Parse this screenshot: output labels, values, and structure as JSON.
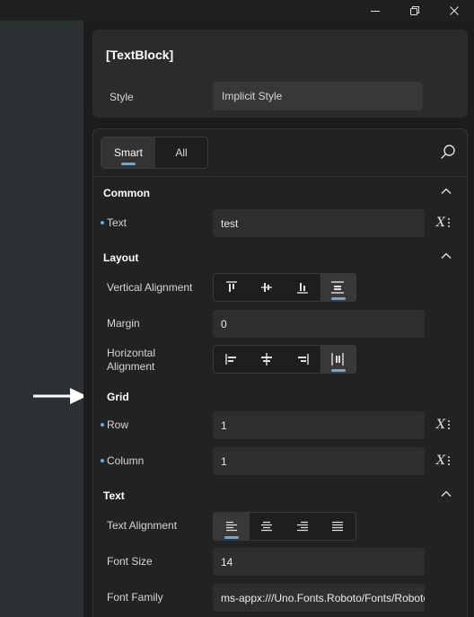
{
  "window": {
    "controls": [
      "minimize-icon",
      "restore-icon",
      "close-icon"
    ]
  },
  "header": {
    "title": "[TextBlock]",
    "style_label": "Style",
    "style_value": "Implicit Style"
  },
  "filter": {
    "smart_label": "Smart",
    "all_label": "All",
    "selected": "Smart",
    "search_icon": "search-icon"
  },
  "sections": {
    "common": {
      "title": "Common",
      "text": {
        "label": "Text",
        "value": "test"
      }
    },
    "layout": {
      "title": "Layout",
      "vertical_alignment": {
        "label": "Vertical Alignment",
        "options": [
          "Top",
          "Center",
          "Bottom",
          "Stretch"
        ],
        "selected": "Stretch"
      },
      "margin": {
        "label": "Margin",
        "value": "0"
      },
      "horizontal_alignment": {
        "label": "Horizontal Alignment",
        "options": [
          "Left",
          "Center",
          "Right",
          "Stretch"
        ],
        "selected": "Stretch"
      }
    },
    "grid": {
      "title": "Grid",
      "row": {
        "label": "Row",
        "value": "1"
      },
      "column": {
        "label": "Column",
        "value": "1"
      }
    },
    "text": {
      "title": "Text",
      "text_alignment": {
        "label": "Text Alignment",
        "options": [
          "Left",
          "Center",
          "Right",
          "Justify"
        ],
        "selected": "Left"
      },
      "font_size": {
        "label": "Font Size",
        "value": "14"
      },
      "font_family": {
        "label": "Font Family",
        "value": "ms-appx:///Uno.Fonts.Roboto/Fonts/Roboto-"
      }
    }
  },
  "colors": {
    "accent": "#6ca6e4",
    "panel_bg": "#1c1c1c",
    "canvas_bg": "#2b3033",
    "field_bg": "#2f2f2f"
  }
}
